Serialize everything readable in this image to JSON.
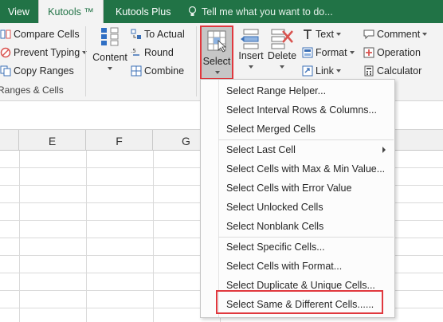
{
  "tabs": {
    "view": "View",
    "kutools": "Kutools ™",
    "kutools_plus": "Kutools Plus",
    "tell_me": "Tell me what you want to do..."
  },
  "ribbon": {
    "compare_cells": "Compare Cells",
    "prevent_typing": "Prevent Typing",
    "copy_ranges": "Copy Ranges",
    "group_label": "Ranges & Cells",
    "content": "Content",
    "to_actual": "To Actual",
    "round": "Round",
    "combine": "Combine",
    "select": "Select",
    "insert": "Insert",
    "delete": "Delete",
    "text": "Text",
    "format": "Format",
    "link": "Link",
    "comment": "Comment",
    "operation": "Operation",
    "calculator": "Calculator"
  },
  "columns": [
    "E",
    "F",
    "G"
  ],
  "menu": {
    "items": [
      "Select Range Helper...",
      "Select Interval Rows & Columns...",
      "Select Merged Cells",
      "Select Last Cell",
      "Select Cells with Max & Min Value...",
      "Select Cells with Error Value",
      "Select Unlocked Cells",
      "Select Nonblank Cells",
      "Select Specific Cells...",
      "Select Cells with Format...",
      "Select Duplicate & Unique Cells...",
      "Select Same & Different Cells......"
    ]
  },
  "colors": {
    "excel_green": "#217346",
    "highlight_red": "#e0383e",
    "ribbon_bg": "#f3f3f3"
  }
}
